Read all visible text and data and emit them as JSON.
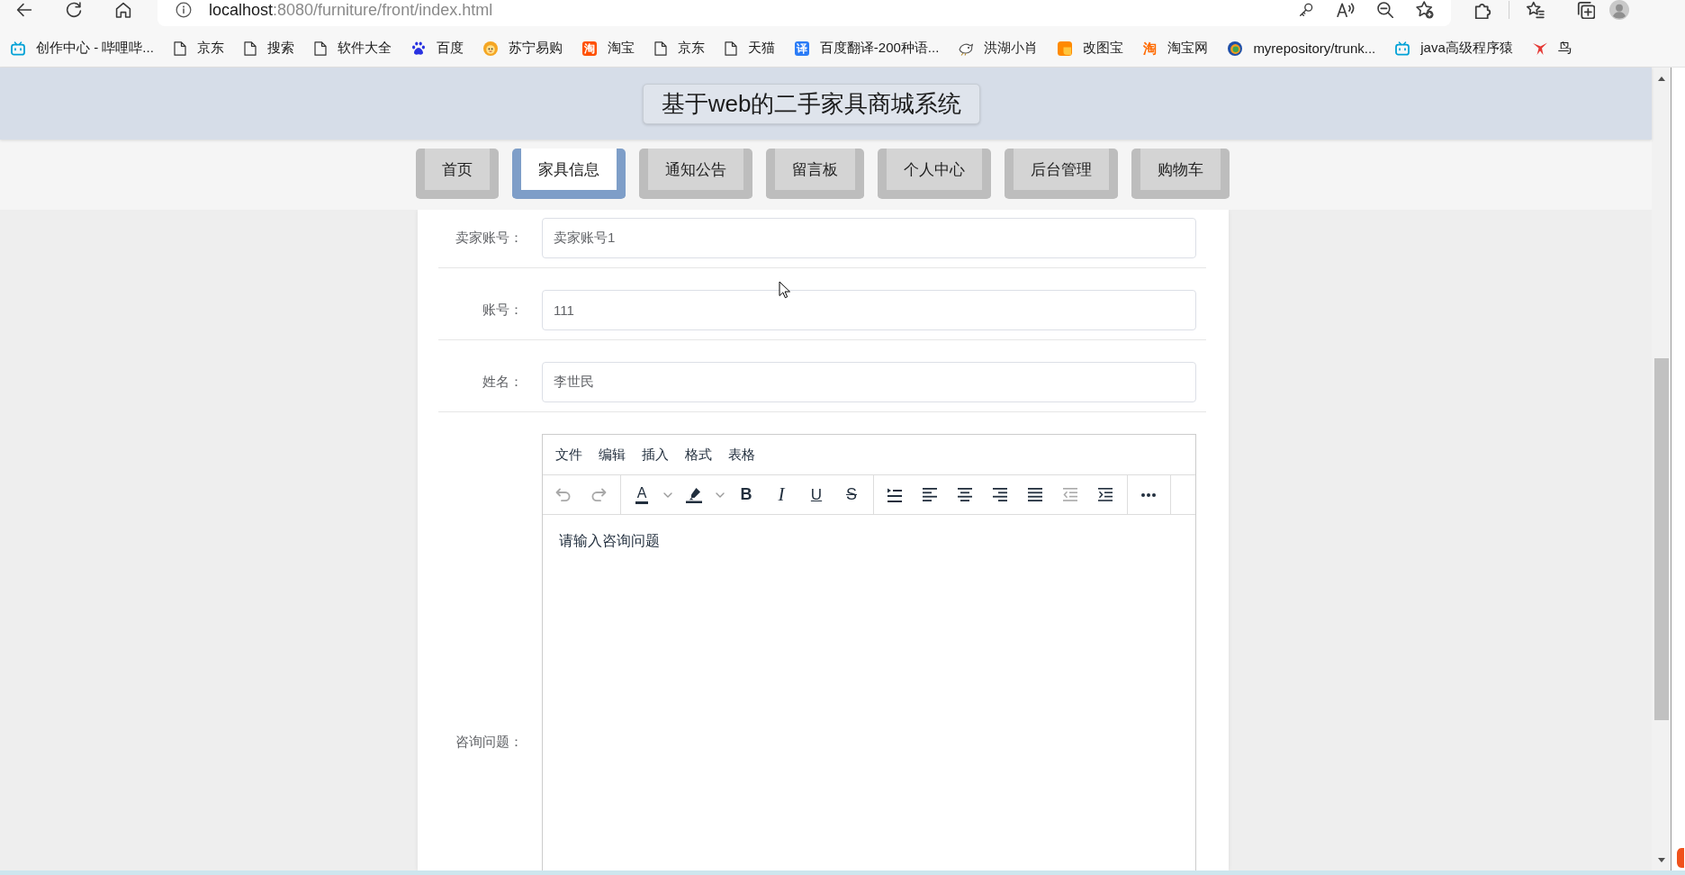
{
  "browser": {
    "url": {
      "host": "localhost",
      "path": ":8080/furniture/front/index.html"
    },
    "bookmarks": [
      {
        "kind": "bilibili",
        "label": "创作中心 - 哔哩哔..."
      },
      {
        "kind": "page",
        "label": "京东"
      },
      {
        "kind": "page",
        "label": "搜索"
      },
      {
        "kind": "page",
        "label": "软件大全"
      },
      {
        "kind": "paw",
        "label": "百度"
      },
      {
        "kind": "lion",
        "label": "苏宁易购"
      },
      {
        "kind": "glyph",
        "glyph": "淘",
        "color": "#ff5000",
        "label": "淘宝"
      },
      {
        "kind": "page",
        "label": "京东"
      },
      {
        "kind": "page",
        "label": "天猫"
      },
      {
        "kind": "glyph",
        "glyph": "译",
        "color": "#2b7cf6",
        "label": "百度翻译-200种语..."
      },
      {
        "kind": "bird",
        "label": "洪湖小肖"
      },
      {
        "kind": "tile",
        "label": "改图宝"
      },
      {
        "kind": "mark",
        "glyph": "淘",
        "color": "#ff6a00",
        "label": "淘宝网"
      },
      {
        "kind": "ring",
        "label": "myrepository/trunk..."
      },
      {
        "kind": "bilibili",
        "label": "java高级程序猿"
      },
      {
        "kind": "swallow",
        "label": "鸟"
      }
    ]
  },
  "header": {
    "title": "基于web的二手家具商城系统"
  },
  "nav": [
    {
      "label": "首页",
      "selected": false
    },
    {
      "label": "家具信息",
      "selected": true
    },
    {
      "label": "通知公告",
      "selected": false
    },
    {
      "label": "留言板",
      "selected": false
    },
    {
      "label": "个人中心",
      "selected": false
    },
    {
      "label": "后台管理",
      "selected": false
    },
    {
      "label": "购物车",
      "selected": false
    }
  ],
  "form": {
    "fields": [
      {
        "label": "卖家账号：",
        "value": "卖家账号1"
      },
      {
        "label": "账号：",
        "value": "111"
      },
      {
        "label": "姓名：",
        "value": "李世民"
      }
    ],
    "editor": {
      "label": "咨询问题：",
      "menus": [
        "文件",
        "编辑",
        "插入",
        "格式",
        "表格"
      ],
      "toolbar": [
        {
          "tools": [
            {
              "kind": "undo",
              "disabled": true
            },
            {
              "kind": "redo",
              "disabled": true
            }
          ]
        },
        {
          "tools": [
            {
              "kind": "forecolor",
              "glyph": "A",
              "disabled": false
            },
            {
              "kind": "backcolor",
              "disabled": false
            },
            {
              "kind": "bold",
              "glyph": "B",
              "disabled": false
            },
            {
              "kind": "italic",
              "glyph": "I",
              "disabled": false
            },
            {
              "kind": "underline",
              "glyph": "U",
              "disabled": false
            },
            {
              "kind": "strikethrough",
              "glyph": "S",
              "disabled": false
            }
          ]
        },
        {
          "tools": [
            {
              "kind": "lineheight",
              "disabled": false
            },
            {
              "kind": "alignleft",
              "disabled": false
            },
            {
              "kind": "aligncenter",
              "disabled": false
            },
            {
              "kind": "alignright",
              "disabled": false
            },
            {
              "kind": "alignjustify",
              "disabled": false
            },
            {
              "kind": "outdent",
              "disabled": true
            },
            {
              "kind": "indent",
              "disabled": false
            }
          ]
        },
        {
          "tools": [
            {
              "kind": "more",
              "disabled": false
            }
          ]
        }
      ],
      "value": "请输入咨询问题"
    }
  }
}
